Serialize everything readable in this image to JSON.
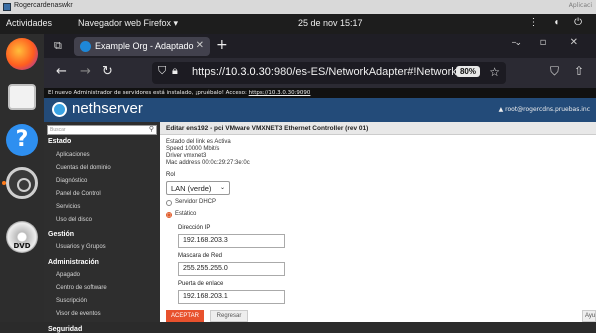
{
  "vm_window": {
    "title": "Rogercardenaswkr",
    "right_text": "Aplicaci"
  },
  "topbar": {
    "activities": "Actividades",
    "app_menu": "Navegador web Firefox ▾",
    "clock": "25 de nov  15:17"
  },
  "browser": {
    "tab_title": "Example Org - Adaptado",
    "url_prefix": "https://",
    "url_host": "10.3.0.30",
    "url_rest": ":980/es-ES/NetworkAdapter#!NetworkAdapter_E",
    "zoom": "80%"
  },
  "notice": {
    "text": "El nuevo Administrador de servidores está instalado, ¡pruébalo! Acceso: ",
    "link": "https://10.3.0.30:9090"
  },
  "nethserver": {
    "logo": "nethserver",
    "user": "root@rogercdns.pruebas.inc"
  },
  "sidebar": {
    "search_placeholder": "Buscar",
    "sections": [
      {
        "title": "Estado",
        "items": [
          "Aplicaciones",
          "Cuentas del dominio",
          "Diagnóstico",
          "Panel de Control",
          "Servicios",
          "Uso del disco"
        ]
      },
      {
        "title": "Gestión",
        "items": [
          "Usuarios y Grupos"
        ]
      },
      {
        "title": "Administración",
        "items": [
          "Apagado",
          "Centro de software",
          "Suscripción",
          "Visor de eventos"
        ]
      },
      {
        "title": "Seguridad",
        "items": []
      }
    ]
  },
  "content": {
    "title": "Editar ens192 - pci VMware VMXNET3 Ethernet Controller (rev 01)",
    "status_lines": [
      "Estado del link es Activa",
      "Speed 10000 Mbit/s",
      "Driver vmxnet3",
      "Mac address 00:0c:29:27:3e:0c"
    ],
    "role_label": "Rol",
    "role_value": "LAN (verde)",
    "radio_dhcp": "Servidor DHCP",
    "radio_static": "Estático",
    "ip_label": "Dirección IP",
    "ip_value": "192.168.203.3",
    "mask_label": "Mascara de Red",
    "mask_value": "255.255.255.0",
    "gateway_label": "Puerta de enlace",
    "gateway_value": "192.168.203.1",
    "accept": "ACEPTAR",
    "reset": "Regresar",
    "help": "Ayu"
  }
}
